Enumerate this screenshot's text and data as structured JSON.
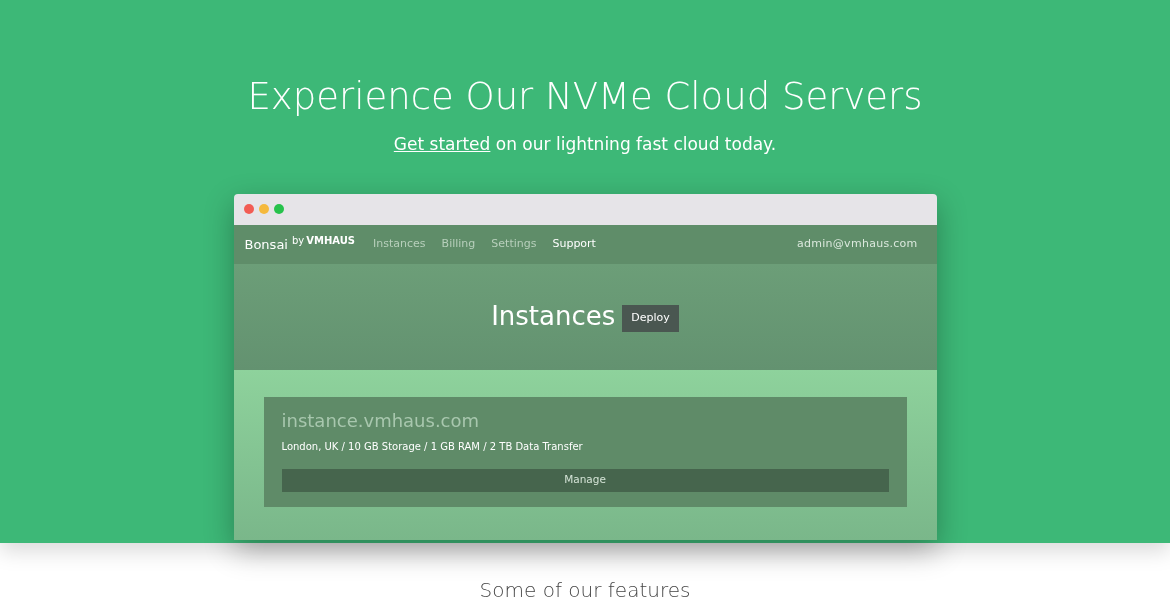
{
  "hero": {
    "title": "Experience Our NVMe Cloud Servers",
    "subtitle_link": "Get started",
    "subtitle_rest": "on our lightning fast cloud today."
  },
  "app_window": {
    "nav": {
      "brand": "Bonsai",
      "brand_by": "by",
      "brand_company": "VMHAUS",
      "items": [
        {
          "label": "Instances",
          "selected": false
        },
        {
          "label": "Billing",
          "selected": false
        },
        {
          "label": "Settings",
          "selected": false
        },
        {
          "label": "Support",
          "selected": true
        }
      ],
      "account": "admin@vmhaus.com"
    },
    "header": {
      "title": "Instances",
      "button": "Deploy"
    },
    "instances": [
      {
        "hostname": "instance.vmhaus.com",
        "details": "London, UK / 10 GB Storage / 1 GB RAM / 2 TB Data Transfer",
        "button": "Manage"
      }
    ]
  },
  "features_heading": "Some of our features"
}
